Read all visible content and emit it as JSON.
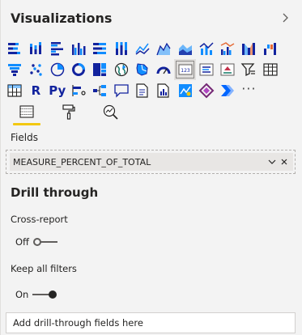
{
  "pane": {
    "title": "Visualizations",
    "collapse_icon": "chevron-right-icon"
  },
  "visual_icons": [
    [
      "stacked-bar-chart-icon",
      "stacked-column-chart-icon",
      "clustered-bar-chart-icon",
      "clustered-column-chart-icon",
      "100-stacked-bar-chart-icon",
      "100-stacked-column-chart-icon",
      "line-chart-icon",
      "area-chart-icon",
      "stacked-area-chart-icon",
      "line-and-stacked-column-chart-icon",
      "line-and-clustered-column-chart-icon",
      "ribbon-chart-icon",
      "waterfall-chart-icon"
    ],
    [
      "funnel-icon",
      "scatter-chart-icon",
      "pie-chart-icon",
      "donut-chart-icon",
      "treemap-icon",
      "map-icon",
      "filled-map-icon",
      "gauge-icon",
      "card-icon",
      "multi-row-card-icon",
      "kpi-icon",
      "slicer-icon",
      "table-icon"
    ],
    [
      "matrix-icon",
      "r-script-visual-icon",
      "python-visual-icon",
      "key-influencers-icon",
      "decomposition-tree-icon",
      "qa-icon",
      "smart-narrative-icon",
      "paginated-report-icon",
      "arcgis-maps-icon",
      "power-apps-icon",
      "power-automate-icon",
      "more-visuals-icon"
    ]
  ],
  "icon_text": {
    "r": "R",
    "py": "Py",
    "more": "···"
  },
  "tabs": [
    {
      "name": "fields-tab-icon",
      "active": true
    },
    {
      "name": "format-paint-roller-icon",
      "active": false
    },
    {
      "name": "analytics-magnifier-icon",
      "active": false
    }
  ],
  "fields": {
    "label": "Fields",
    "value": "MEASURE_PERCENT_OF_TOTAL"
  },
  "drill_through": {
    "title": "Drill through",
    "cross_report_label": "Cross-report",
    "cross_report_state": "Off",
    "keep_filters_label": "Keep all filters",
    "keep_filters_state": "On",
    "dropzone_text": "Add drill-through fields here"
  },
  "colors": {
    "accent_yellow": "#f2c811",
    "teal": "#117865",
    "blue": "#118dff",
    "dark_blue": "#12239e"
  }
}
